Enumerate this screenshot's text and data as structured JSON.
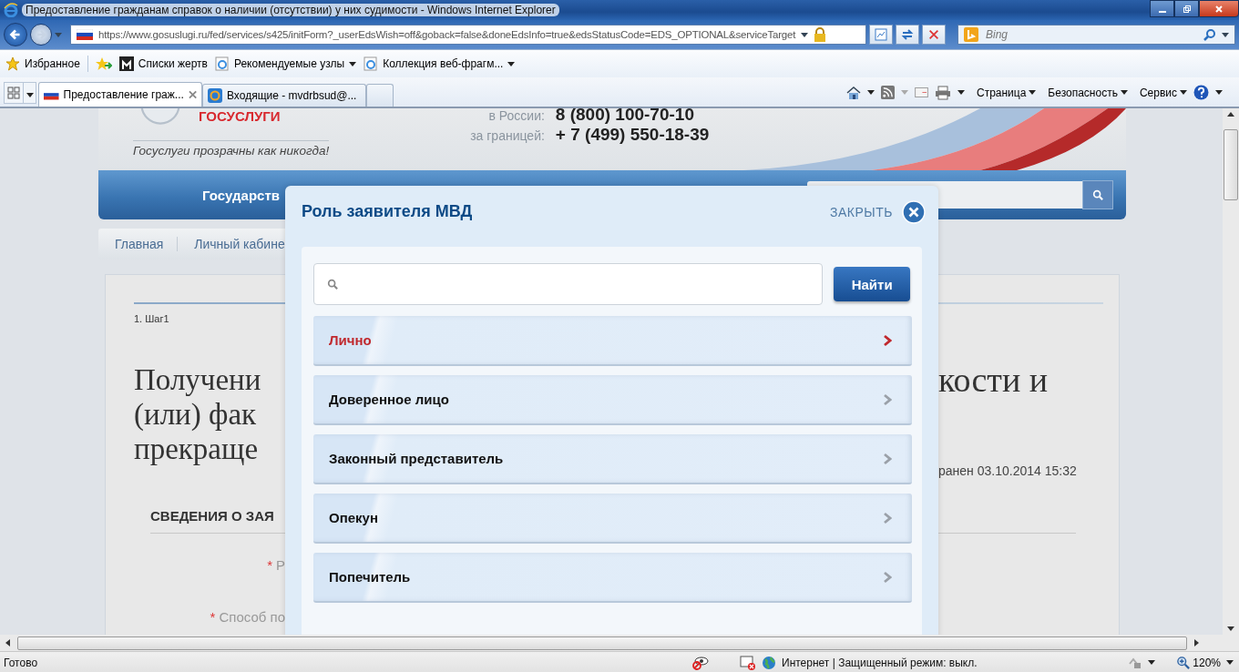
{
  "window": {
    "title": "Предоставление гражданам справок о наличии (отсутствии) у них судимости - Windows Internet Explorer"
  },
  "address_bar": {
    "url": "https://www.gosuslugi.ru/fed/services/s425/initForm?_userEdsWish=off&goback=false&doneEdsInfo=true&edsStatusCode=EDS_OPTIONAL&serviceTarget"
  },
  "search_box": {
    "placeholder": "Bing"
  },
  "favorites_bar": [
    {
      "label": "Избранное",
      "kind": "star",
      "dropdown": false
    },
    {
      "label": "Списки жертв",
      "kind": "site",
      "dropdown": false
    },
    {
      "label": "Рекомендуемые узлы",
      "kind": "ie",
      "dropdown": true
    },
    {
      "label": "Коллекция веб-фрагм...",
      "kind": "ie",
      "dropdown": true
    }
  ],
  "tabs": [
    {
      "label": "Предоставление граж...",
      "selected": true
    },
    {
      "label": "Входящие - mvdrbsud@...",
      "selected": false
    }
  ],
  "command_bar": [
    "Страница",
    "Безопасность",
    "Сервис"
  ],
  "page": {
    "logo": "ГОСУСЛУГИ",
    "tagline": "Госуслуги прозрачны как никогда!",
    "phones": [
      {
        "label": "в России:",
        "number": "8 (800) 100-70-10"
      },
      {
        "label": "за границей:",
        "number": "+ 7 (499) 550-18-39"
      }
    ],
    "nav_item": "Государств",
    "breadcrumbs": [
      "Главная",
      "Личный кабине"
    ],
    "step": "1. Шаг1",
    "heading_left": [
      "Получени",
      "(или) фак",
      "прекраще"
    ],
    "heading_right": "кости и",
    "saved": "ранен 03.10.2014 15:32",
    "section": "СВЕДЕНИЯ О ЗАЯ",
    "fields": [
      {
        "mark": "*",
        "label": "Р"
      },
      {
        "mark": "*",
        "label": "Способ по"
      }
    ]
  },
  "dialog": {
    "title": "Роль заявителя МВД",
    "close": "ЗАКРЫТЬ",
    "search_button": "Найти",
    "options": [
      {
        "label": "Лично",
        "selected": true
      },
      {
        "label": "Доверенное лицо",
        "selected": false
      },
      {
        "label": "Законный представитель",
        "selected": false
      },
      {
        "label": "Опекун",
        "selected": false
      },
      {
        "label": "Попечитель",
        "selected": false
      }
    ]
  },
  "status_bar": {
    "text": "Готово",
    "zone": "Интернет | Защищенный режим: выкл.",
    "zoom": "120%"
  }
}
